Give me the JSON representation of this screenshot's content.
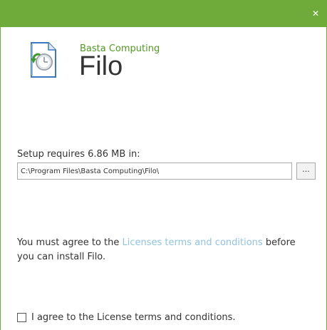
{
  "window": {
    "close_glyph": "✕"
  },
  "header": {
    "company": "Basta Computing",
    "product": "Filo",
    "icon": "document-clock-icon"
  },
  "install": {
    "requires_label": "Setup requires 6.86 MB in:",
    "path_value": "C:\\Program Files\\Basta Computing\\Filo\\",
    "browse_label": "..."
  },
  "license": {
    "text_before": "You must agree to the ",
    "link_text": "Licenses terms and conditions",
    "text_after": " before you can install Filo.",
    "checkbox_label": "I agree to the License terms and conditions.",
    "checked": false
  },
  "colors": {
    "titlebar": "#6eab3a",
    "company": "#4f9a1e",
    "link": "#8fc3e0"
  }
}
